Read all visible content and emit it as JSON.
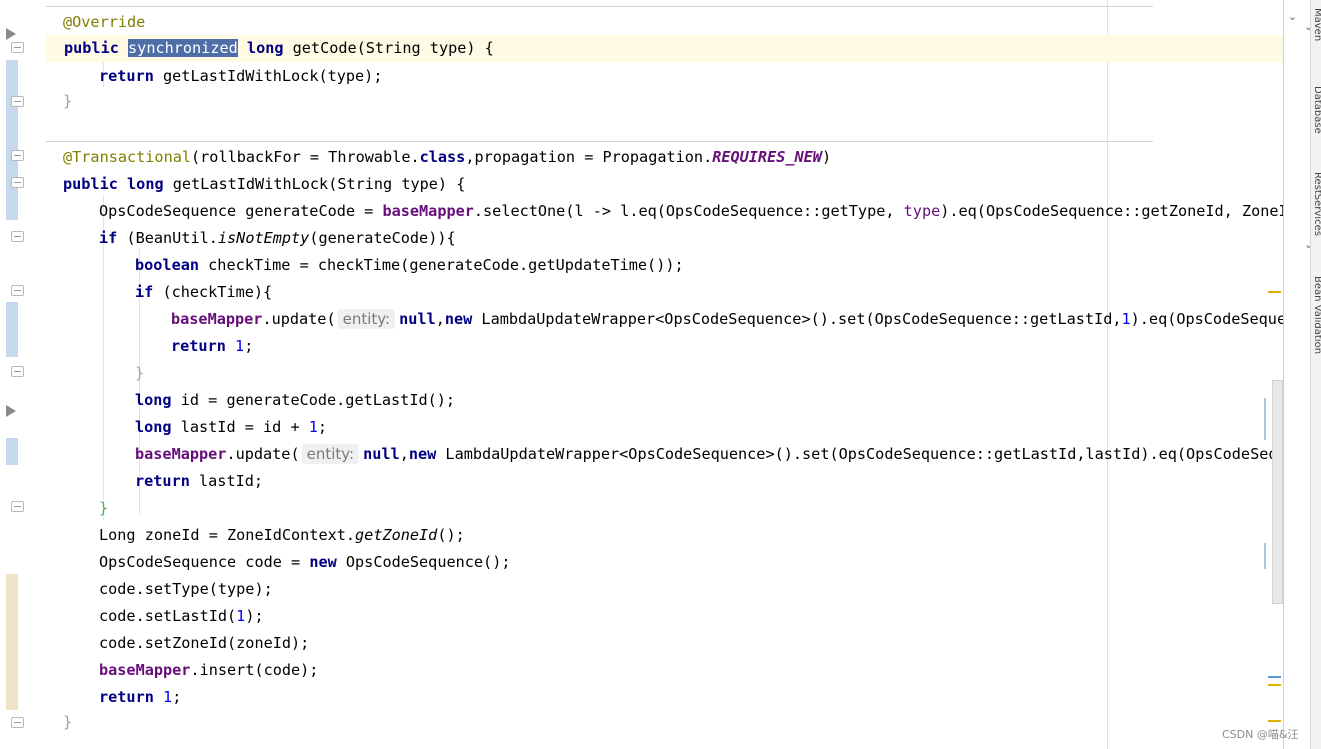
{
  "editor": {
    "lines": {
      "l1_annotation": "@Override",
      "l2_public": "public",
      "l2_synchronized": "synchronized",
      "l2_long": "long",
      "l2_sig": " getCode(String type) {",
      "l3_return": "return",
      "l3_rest": " getLastIdWithLock(type);",
      "l4": "}",
      "l6_annotation": "@Transactional",
      "l6_a": "(rollbackFor = Throwable.",
      "l6_class": "class",
      "l6_b": ",propagation = Propagation.",
      "l6_const": "REQUIRES_NEW",
      "l6_c": ")",
      "l7_public": "public",
      "l7_long": "long",
      "l7_sig": " getLastIdWithLock(String type) {",
      "l8_a": "OpsCodeSequence generateCode = ",
      "l8_field": "baseMapper",
      "l8_b": ".selectOne(l -> l.eq(OpsCodeSequence::getType, ",
      "l8_type": "type",
      "l8_c": ").eq(OpsCodeSequence::getZoneId, ZoneIdC",
      "l9_if": "if",
      "l9_a": " (BeanUtil.",
      "l9_method": "isNotEmpty",
      "l9_b": "(generateCode)){",
      "l10_boolean": "boolean",
      "l10_rest": " checkTime = checkTime(generateCode.getUpdateTime());",
      "l11_if": "if",
      "l11_rest": " (checkTime){",
      "l12_field": "baseMapper",
      "l12_a": ".update(",
      "l12_hint": "entity:",
      "l12_null": "null",
      "l12_new": "new",
      "l12_b": " LambdaUpdateWrapper<OpsCodeSequence>().set(OpsCodeSequence::getLastId,",
      "l12_num": "1",
      "l12_c": ").eq(OpsCodeSequence",
      "l13_return": "return",
      "l13_num": "1",
      "l13_semi": ";",
      "l14": "}",
      "l15_long": "long",
      "l15_rest": " id = generateCode.getLastId();",
      "l16_long": "long",
      "l16_a": " lastId = id + ",
      "l16_num": "1",
      "l16_semi": ";",
      "l17_field": "baseMapper",
      "l17_a": ".update(",
      "l17_hint": "entity:",
      "l17_null": "null",
      "l17_new": "new",
      "l17_b": " LambdaUpdateWrapper<OpsCodeSequence>().set(OpsCodeSequence::getLastId,lastId).eq(OpsCodeSequen",
      "l18_return": "return",
      "l18_rest": " lastId;",
      "l19": "}",
      "l20_a": "Long zoneId = ZoneIdContext.",
      "l20_method": "getZoneId",
      "l20_b": "();",
      "l21_a": "OpsCodeSequence code = ",
      "l21_new": "new",
      "l21_b": " OpsCodeSequence();",
      "l22": "code.setType(type);",
      "l23_a": "code.setLastId(",
      "l23_num": "1",
      "l23_b": ");",
      "l24": "code.setZoneId(zoneId);",
      "l25_field": "baseMapper",
      "l25_rest": ".insert(code);",
      "l26_return": "return",
      "l26_num": "1",
      "l26_semi": ";",
      "l27": "}"
    }
  },
  "side_panel": {
    "tab_maven": "Maven",
    "tab_database": "Database",
    "tab_rest_services": "RestServices",
    "tab_bean_validation": "Bean Validation"
  },
  "watermark": "CSDN @喵&汪",
  "colors": {
    "keyword": "#000080",
    "annotation": "#808000",
    "field": "#660e7a",
    "number": "#0000ff",
    "selection": "#4f6ea8",
    "caret_row": "#fffae3",
    "change_modified": "#c6d8ec",
    "change_added": "#efe2c8"
  }
}
